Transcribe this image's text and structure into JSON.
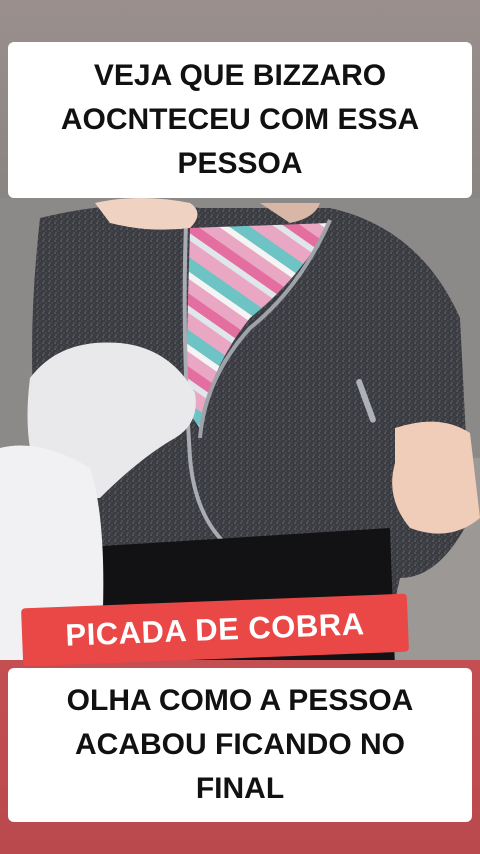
{
  "top_caption": {
    "text": "VEJA QUE BIZZARO\nAOCNTECEU COM ESSA\nPESSOA"
  },
  "badge": {
    "text": "PICADA DE COBRA"
  },
  "bottom_caption": {
    "text": "OLHA COMO A PESSOA\nACABOU FICANDO NO\nFINAL"
  },
  "colors": {
    "caption_bg": "#ffffff",
    "caption_text": "#111111",
    "badge_bg": "#ea4747",
    "badge_text": "#ffffff",
    "jacket": "#3b3d42",
    "glove": "#e9e9ec"
  }
}
